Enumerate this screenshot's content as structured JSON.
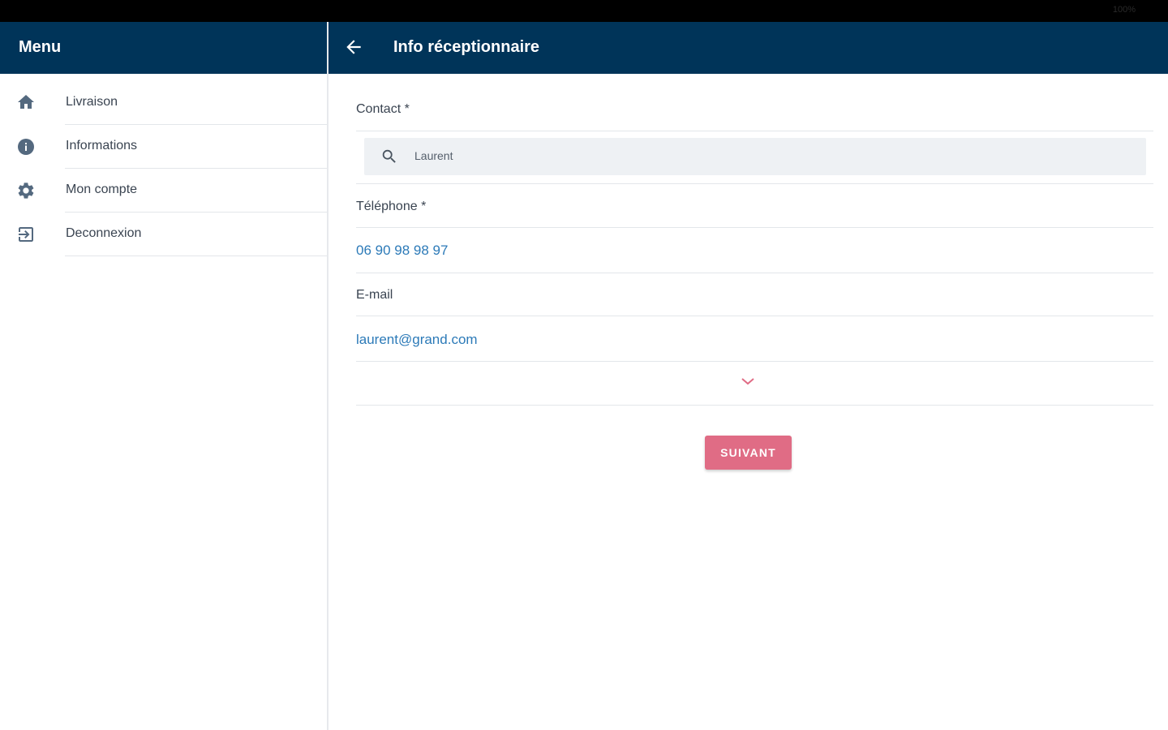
{
  "status_bar": {
    "battery_text": "100%"
  },
  "sidebar": {
    "title": "Menu",
    "items": [
      {
        "label": "Livraison",
        "icon": "home-icon"
      },
      {
        "label": "Informations",
        "icon": "info-icon"
      },
      {
        "label": "Mon compte",
        "icon": "gear-icon"
      },
      {
        "label": "Deconnexion",
        "icon": "logout-icon"
      }
    ]
  },
  "header": {
    "title": "Info réceptionnaire",
    "back_icon": "arrow-left-icon"
  },
  "form": {
    "contact_label": "Contact *",
    "contact_value": "Laurent",
    "telephone_label": "Téléphone *",
    "telephone_value": "06 90 98 98 97",
    "email_label": "E-mail",
    "email_value": "laurent@grand.com",
    "expand_icon": "chevron-down-icon",
    "next_button": "SUIVANT"
  },
  "colors": {
    "header_bg": "#003459",
    "link": "#2c7ab8",
    "accent": "#e06c85",
    "icon": "#54697f"
  }
}
